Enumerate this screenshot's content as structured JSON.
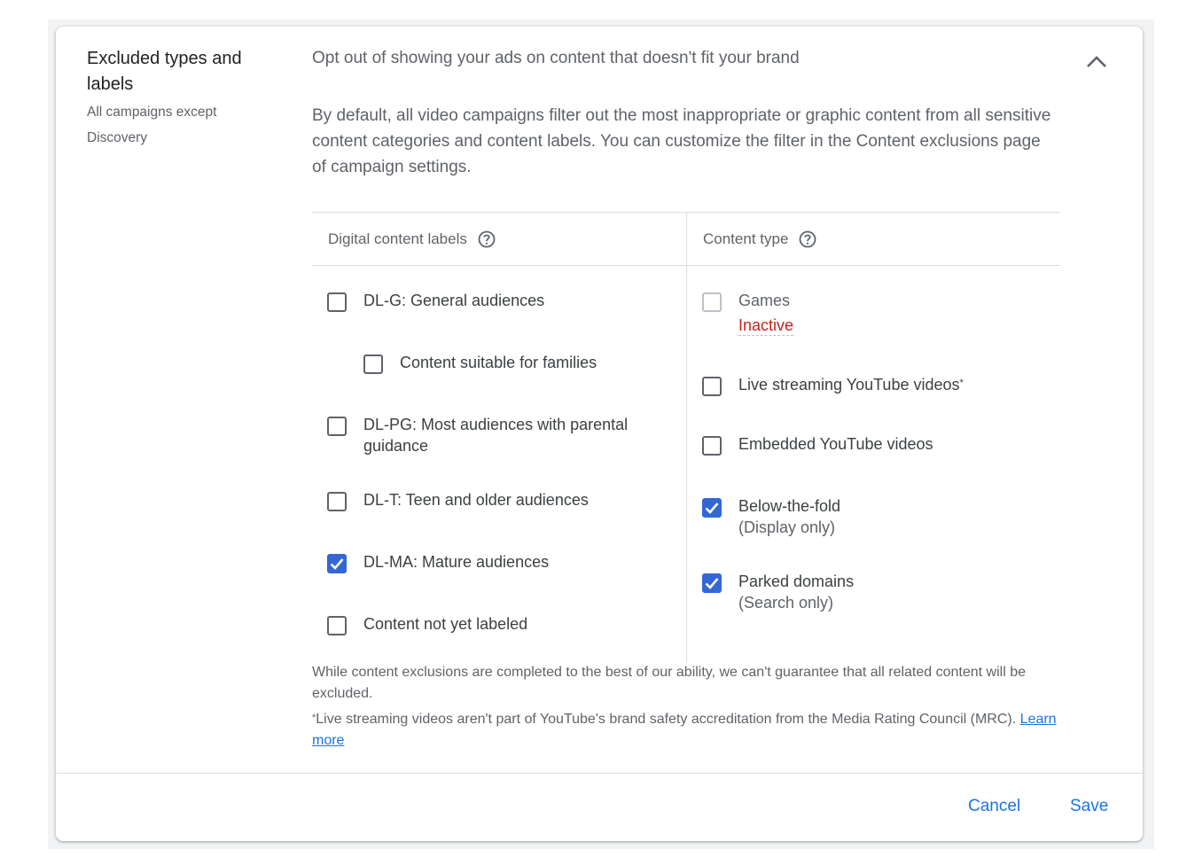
{
  "section": {
    "title": "Excluded types and labels",
    "subtitle": "All campaigns except Discovery",
    "summary": "Opt out of showing your ads on content that doesn't fit your brand",
    "collapse_icon": "chevron-up-icon",
    "intro": "By default, all video campaigns filter out the most inappropriate or graphic content from all sensitive content categories and content labels. You can customize the filter in the Content exclusions page of campaign settings."
  },
  "digital_labels": {
    "header": "Digital content labels",
    "help_icon": "help-circle-icon",
    "options": [
      {
        "label": "DL-G: General audiences",
        "checked": false
      },
      {
        "label": "Content suitable for families",
        "checked": false
      },
      {
        "label": "DL-PG: Most audiences with parental guidance",
        "checked": false
      },
      {
        "label": "DL-T: Teen and older audiences",
        "checked": false
      },
      {
        "label": "DL-MA: Mature audiences",
        "checked": true
      },
      {
        "label": "Content not yet labeled",
        "checked": false
      }
    ]
  },
  "content_type": {
    "header": "Content type",
    "help_icon": "help-circle-icon",
    "options": [
      {
        "label": "Games",
        "status": "Inactive",
        "checked": false,
        "disabled": true
      },
      {
        "label": "Live streaming YouTube videos",
        "footnote_mark": "*",
        "checked": false
      },
      {
        "label": "Embedded YouTube videos",
        "checked": false
      },
      {
        "label": "Below-the-fold",
        "sublabel": "(Display only)",
        "checked": true
      },
      {
        "label": "Parked domains",
        "sublabel": "(Search only)",
        "checked": true
      }
    ]
  },
  "notes": {
    "disclaimer": "While content exclusions are completed to the best of our ability, we can't guarantee that all related content will be excluded.",
    "footnote_mark": "*",
    "footnote": "Live streaming videos aren't part of YouTube's brand safety accreditation from the Media Rating Council (MRC). ",
    "learn_more": "Learn more"
  },
  "footer": {
    "cancel_label": "Cancel",
    "save_label": "Save"
  },
  "colors": {
    "accent": "#1a73e8",
    "checkbox_checked": "#3367d6",
    "inactive": "#c5221f"
  }
}
